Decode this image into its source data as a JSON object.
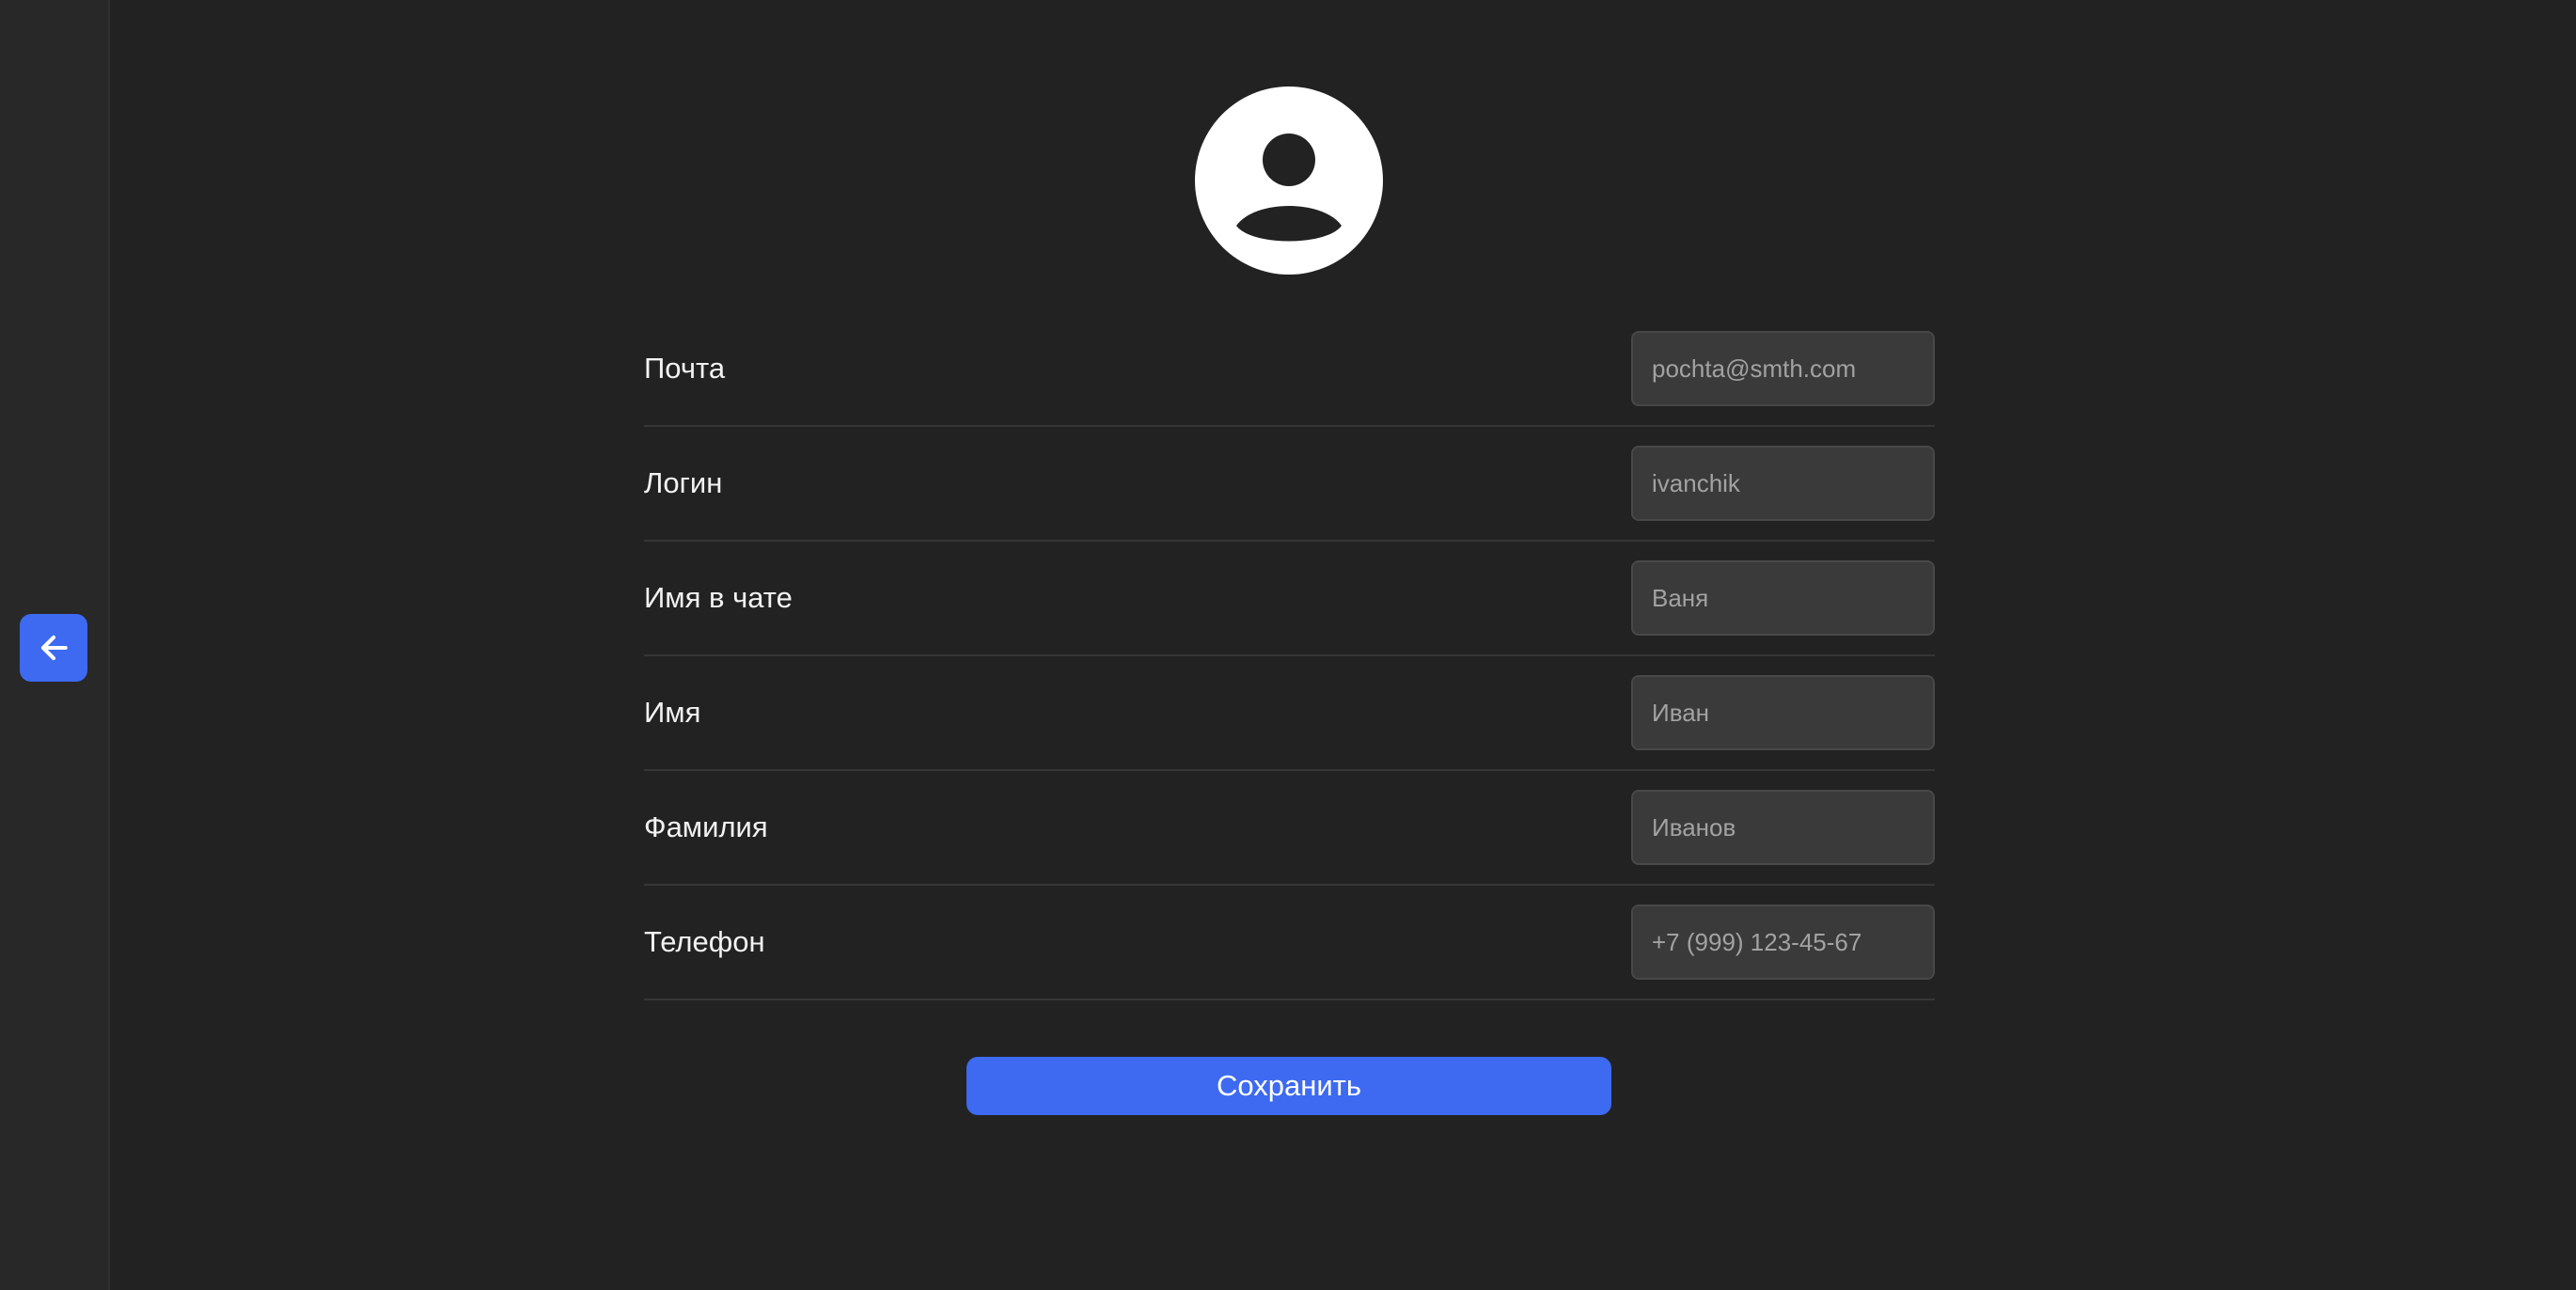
{
  "accent_color": "#3d6af0",
  "back_button": {
    "icon": "arrow-left-icon"
  },
  "avatar": {
    "icon": "user-avatar-icon"
  },
  "form": {
    "fields": [
      {
        "key": "email",
        "label": "Почта",
        "placeholder": "pochta@smth.com",
        "value": ""
      },
      {
        "key": "login",
        "label": "Логин",
        "placeholder": "ivanchik",
        "value": ""
      },
      {
        "key": "chatname",
        "label": "Имя в чате",
        "placeholder": "Ваня",
        "value": ""
      },
      {
        "key": "name",
        "label": "Имя",
        "placeholder": "Иван",
        "value": ""
      },
      {
        "key": "surname",
        "label": "Фамилия",
        "placeholder": "Иванов",
        "value": ""
      },
      {
        "key": "phone",
        "label": "Телефон",
        "placeholder": "+7 (999) 123-45-67",
        "value": ""
      }
    ],
    "save_label": "Сохранить"
  }
}
